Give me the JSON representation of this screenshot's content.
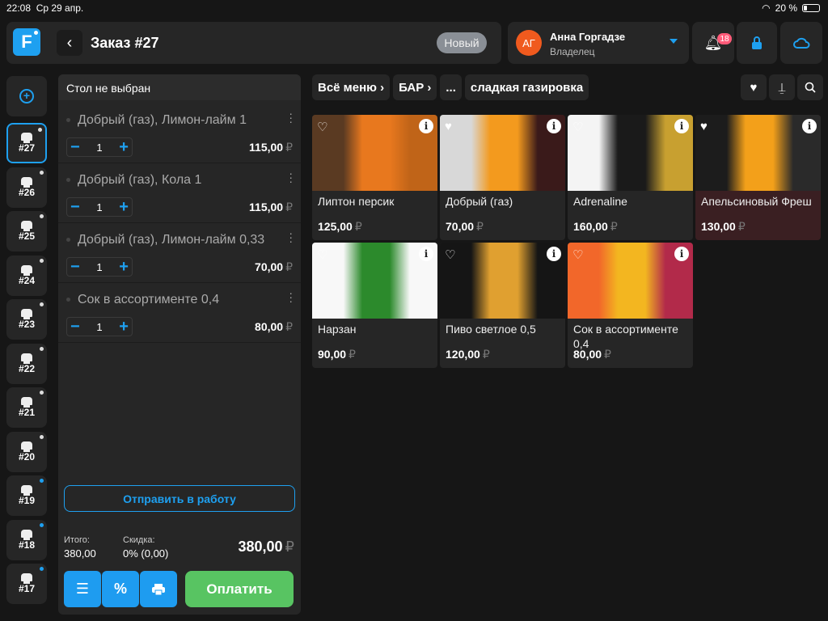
{
  "status": {
    "time": "22:08",
    "date": "Ср 29 апр.",
    "battery": "20 %",
    "battery_level": 0.2
  },
  "header": {
    "logo": "F",
    "title": "Заказ #27",
    "badge": "Новый",
    "user_initials": "АГ",
    "user_name": "Анна Горгадзе",
    "user_role": "Владелец",
    "notifications": "18"
  },
  "order_tabs": [
    {
      "num": "#27",
      "active": true,
      "dot": "white"
    },
    {
      "num": "#26",
      "dot": "white"
    },
    {
      "num": "#25",
      "dot": "white"
    },
    {
      "num": "#24",
      "dot": "white"
    },
    {
      "num": "#23",
      "dot": "white"
    },
    {
      "num": "#22",
      "dot": "white"
    },
    {
      "num": "#21",
      "dot": "white"
    },
    {
      "num": "#20",
      "dot": "white"
    },
    {
      "num": "#19",
      "dot": "blue"
    },
    {
      "num": "#18",
      "dot": "blue"
    },
    {
      "num": "#17",
      "dot": "blue"
    }
  ],
  "order": {
    "table": "Стол не выбран",
    "lines": [
      {
        "name": "Добрый (газ), Лимон-лайм 1",
        "qty": "1",
        "price": "115,00"
      },
      {
        "name": "Добрый (газ), Кола 1",
        "qty": "1",
        "price": "115,00"
      },
      {
        "name": "Добрый (газ), Лимон-лайм 0,33",
        "qty": "1",
        "price": "70,00"
      },
      {
        "name": "Сок в ассортименте 0,4",
        "qty": "1",
        "price": "80,00"
      }
    ],
    "currency": "₽",
    "send_label": "Отправить в работу",
    "total_label": "Итого:",
    "total_value": "380,00",
    "discount_label": "Скидка:",
    "discount_value": "0% (0,00)",
    "grand_total": "380,00",
    "pay_label": "Оплатить",
    "minus": "−",
    "plus": "+"
  },
  "breadcrumbs": [
    "Всё меню ›",
    "БАР ›",
    "...",
    "сладкая газировка"
  ],
  "products": [
    {
      "name": "Липтон персик",
      "price": "125,00",
      "fav": false,
      "colors": [
        "#5a3a22",
        "#e8781e",
        "#c06418"
      ]
    },
    {
      "name": "Добрый (газ)",
      "price": "70,00",
      "fav": true,
      "colors": [
        "#d8d8d8",
        "#f39a1e",
        "#3a1a1a"
      ]
    },
    {
      "name": "Adrenaline",
      "price": "160,00",
      "fav": false,
      "colors": [
        "#f4f4f4",
        "#1a1a1a",
        "#c8a030"
      ]
    },
    {
      "name": "Апельсиновый Фреш",
      "price": "130,00",
      "fav": true,
      "highlight": true,
      "colors": [
        "#1c1c1c",
        "#f3a01a",
        "#2a2a2a"
      ]
    },
    {
      "name": "Нарзан",
      "price": "90,00",
      "fav": false,
      "colors": [
        "#f8f8f8",
        "#2c8a2c",
        "#f8f8f8"
      ]
    },
    {
      "name": "Пиво светлое 0,5",
      "price": "120,00",
      "fav": false,
      "colors": [
        "#151515",
        "#e0a030",
        "#151515"
      ]
    },
    {
      "name": "Сок в ассортименте 0,4",
      "price": "80,00",
      "fav": false,
      "colors": [
        "#f2672a",
        "#f3b620",
        "#b22a4a"
      ]
    }
  ],
  "colors": {
    "accent": "#1ea0f0",
    "pay": "#58c462",
    "avatar": "#f05a1e",
    "notif": "#ff5a78"
  }
}
